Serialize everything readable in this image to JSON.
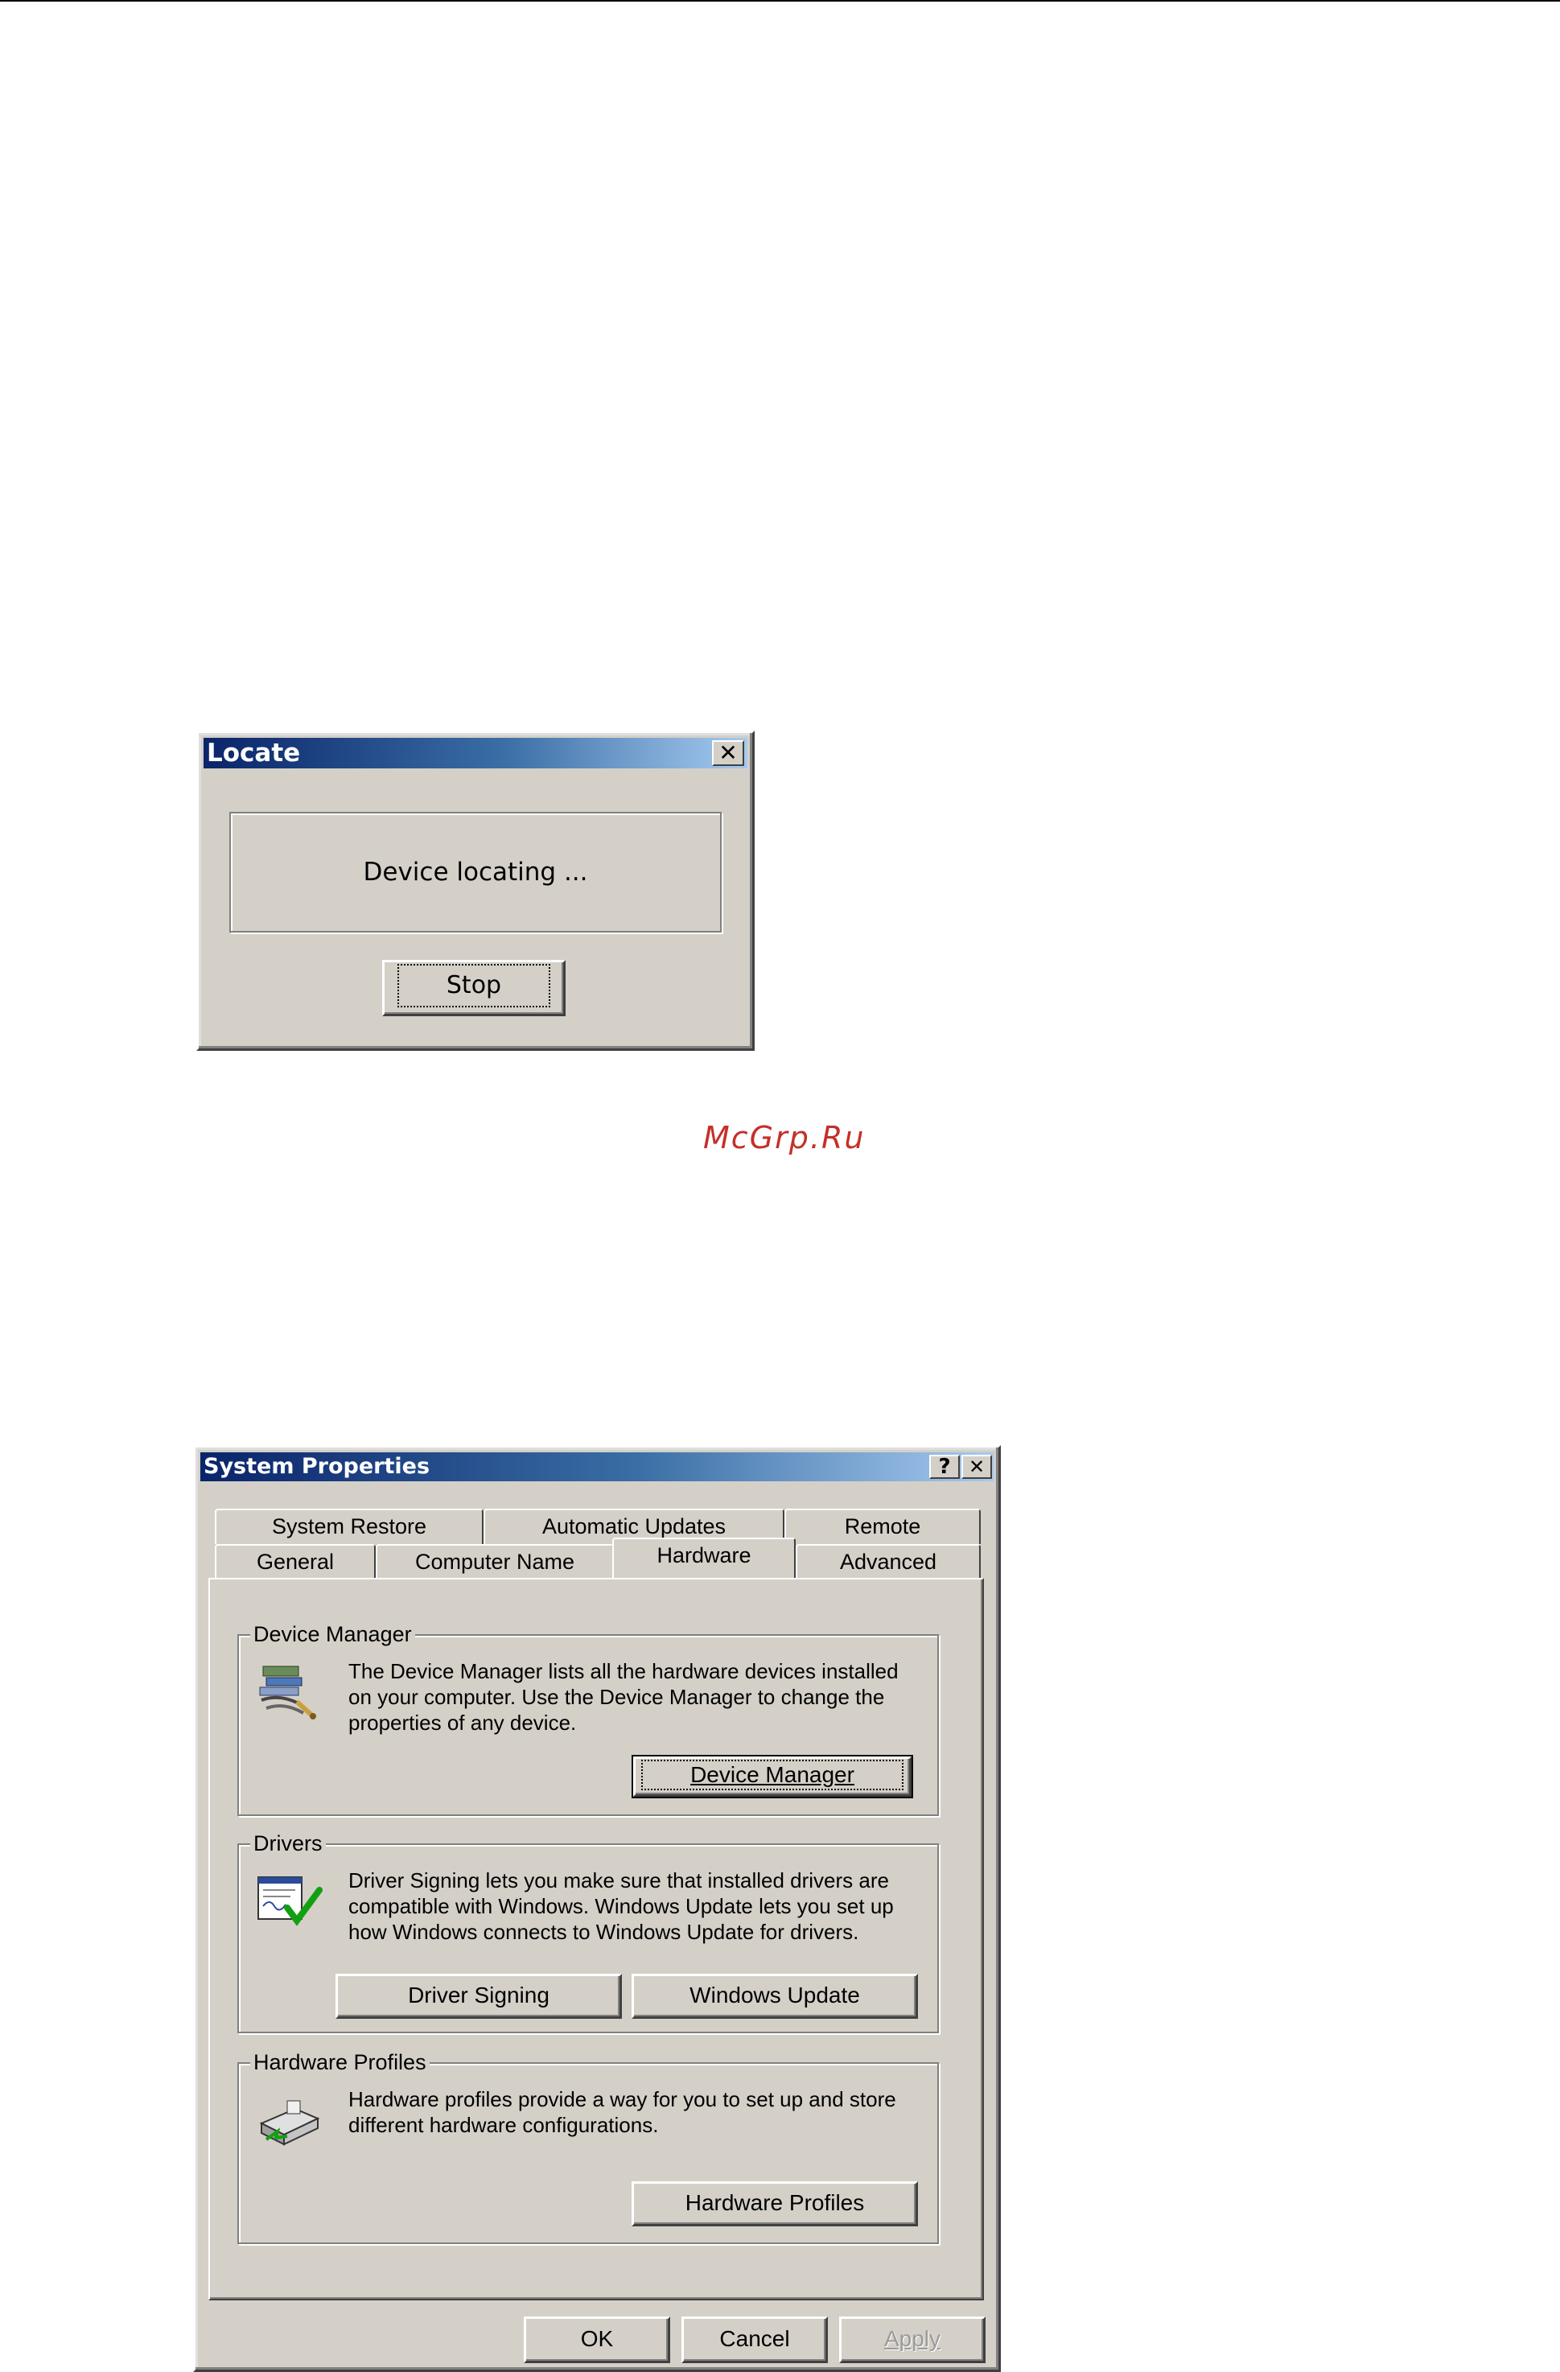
{
  "watermark": "McGrp.Ru",
  "locate_dialog": {
    "title": "Locate",
    "close_glyph": "✕",
    "status_text": "Device locating ...",
    "stop_label": "Stop"
  },
  "system_properties": {
    "title": "System Properties",
    "help_glyph": "?",
    "close_glyph": "✕",
    "tabs_row1": [
      "System Restore",
      "Automatic Updates",
      "Remote"
    ],
    "tabs_row2": [
      "General",
      "Computer Name",
      "Hardware",
      "Advanced"
    ],
    "active_tab": "Hardware",
    "device_manager": {
      "group_title": "Device Manager",
      "description": "The Device Manager lists all the hardware devices installed on your computer. Use the Device Manager to change the properties of any device.",
      "button_label": "Device Manager",
      "icon": "device-manager-icon"
    },
    "drivers": {
      "group_title": "Drivers",
      "description": "Driver Signing lets you make sure that installed drivers are compatible with Windows. Windows Update lets you set up how Windows connects to Windows Update for drivers.",
      "driver_signing_label": "Driver Signing",
      "windows_update_label": "Windows Update",
      "icon": "driver-signing-icon"
    },
    "hardware_profiles": {
      "group_title": "Hardware Profiles",
      "description": "Hardware profiles provide a way for you to set up and store different hardware configurations.",
      "button_label": "Hardware Profiles",
      "icon": "hardware-profiles-icon"
    },
    "ok_label": "OK",
    "cancel_label": "Cancel",
    "apply_label": "Apply"
  }
}
